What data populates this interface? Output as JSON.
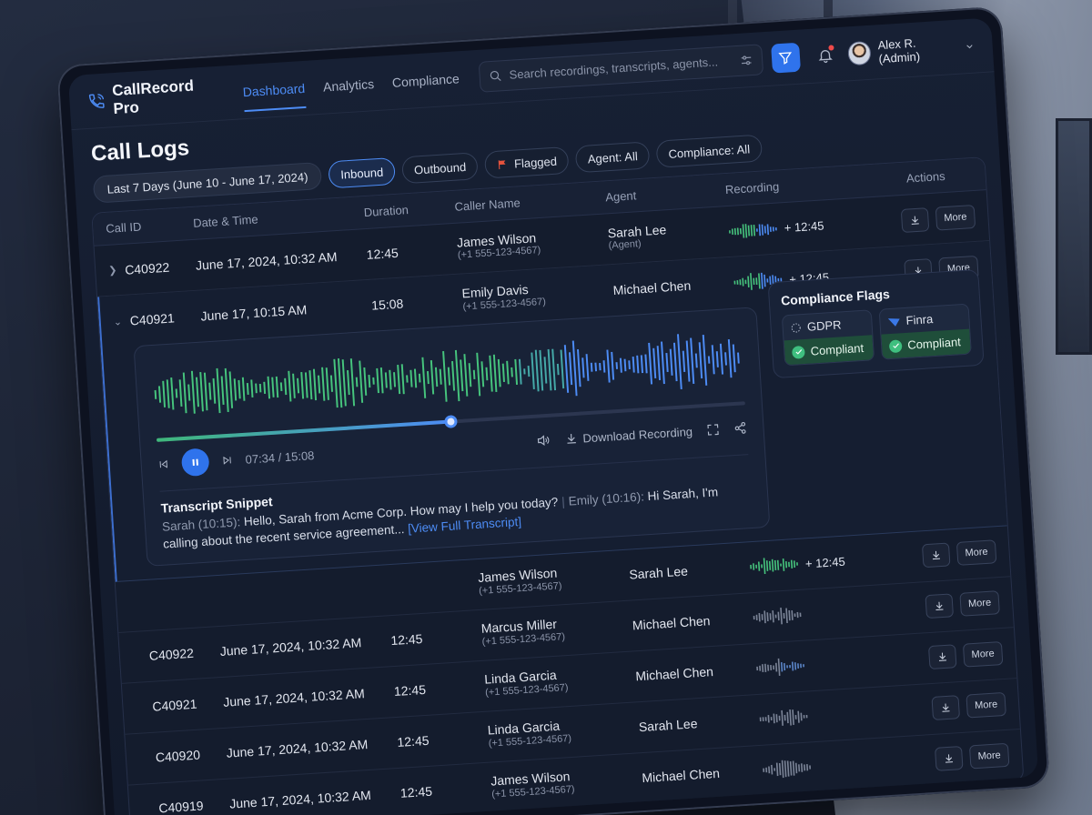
{
  "app": {
    "name": "CallRecord Pro"
  },
  "nav": {
    "tabs": [
      {
        "label": "Dashboard",
        "active": true
      },
      {
        "label": "Analytics",
        "active": false
      },
      {
        "label": "Compliance",
        "active": false
      }
    ]
  },
  "search": {
    "placeholder": "Search recordings, transcripts, agents...",
    "value": ""
  },
  "user": {
    "name": "Alex R. (Admin)"
  },
  "page": {
    "title": "Call Logs"
  },
  "filters": {
    "date_range": "Last 7 Days (June 10 - June 17, 2024)",
    "chips": [
      {
        "label": "Inbound",
        "active": true
      },
      {
        "label": "Outbound",
        "active": false
      },
      {
        "label": "Flagged",
        "active": false
      },
      {
        "label": "Agent: All",
        "active": false
      },
      {
        "label": "Compliance: All",
        "active": false
      }
    ]
  },
  "table": {
    "headers": [
      "Call ID",
      "Date & Time",
      "Duration",
      "Caller Name",
      "Agent",
      "Recording",
      "Actions"
    ],
    "more_label": "More",
    "rows_top": [
      {
        "id": "C40922",
        "datetime": "June 17, 2024, 10:32 AM",
        "duration": "12:45",
        "caller": "James Wilson",
        "phone": "(+1 555-123-4567)",
        "agent": "Sarah Lee",
        "agent_sub": "(Agent)",
        "recording": "+ 12:45",
        "wave": "green-blue"
      }
    ],
    "expanded_row": {
      "id": "C40921",
      "datetime": "June 17, 10:15 AM",
      "duration": "15:08",
      "caller": "Emily Davis",
      "phone": "(+1 555-123-4567)",
      "agent": "Michael Chen",
      "recording": "+ 12:45"
    },
    "rows_bottom": [
      {
        "id": "",
        "datetime": "",
        "duration": "",
        "caller": "James Wilson",
        "phone": "(+1 555-123-4567)",
        "agent": "Sarah Lee",
        "recording": "+ 12:45",
        "wave": "green"
      },
      {
        "id": "C40922",
        "datetime": "June 17, 2024, 10:32 AM",
        "duration": "12:45",
        "caller": "Marcus Miller",
        "phone": "(+1 555-123-4567)",
        "agent": "Michael Chen",
        "recording": "",
        "wave": "gray"
      },
      {
        "id": "C40921",
        "datetime": "June 17, 2024, 10:32 AM",
        "duration": "12:45",
        "caller": "Linda Garcia",
        "phone": "(+1 555-123-4567)",
        "agent": "Michael Chen",
        "recording": "",
        "wave": "gray-blue"
      },
      {
        "id": "C40920",
        "datetime": "June 17, 2024, 10:32 AM",
        "duration": "12:45",
        "caller": "Linda Garcia",
        "phone": "(+1 555-123-4567)",
        "agent": "Sarah Lee",
        "recording": "",
        "wave": "gray"
      },
      {
        "id": "C40919",
        "datetime": "June 17, 2024, 10:32 AM",
        "duration": "12:45",
        "caller": "James Wilson",
        "phone": "(+1 555-123-4567)",
        "agent": "Michael Chen",
        "recording": "",
        "wave": "gray"
      }
    ]
  },
  "player": {
    "current_time": "07:34 / 15:08",
    "progress": 0.5,
    "download_label": "Download Recording"
  },
  "transcript": {
    "title": "Transcript Snippet",
    "speaker1": "Sarah (10:15):",
    "line1": "Hello, Sarah from Acme Corp. How may I help you today?",
    "speaker2": "Emily (10:16):",
    "line2": "Hi Sarah, I'm calling about the recent service agreement...",
    "link": "[View Full Transcript]"
  },
  "compliance": {
    "title": "Compliance Flags",
    "items": [
      {
        "name": "GDPR",
        "status": "Compliant"
      },
      {
        "name": "Finra",
        "status": "Compliant"
      }
    ]
  },
  "colors": {
    "accent": "#4d8cf5",
    "primary_button": "#2f73ec",
    "wave_green": "#46c47d",
    "wave_blue": "#4d8cf5",
    "compliant_bg": "#1f4e3a"
  }
}
